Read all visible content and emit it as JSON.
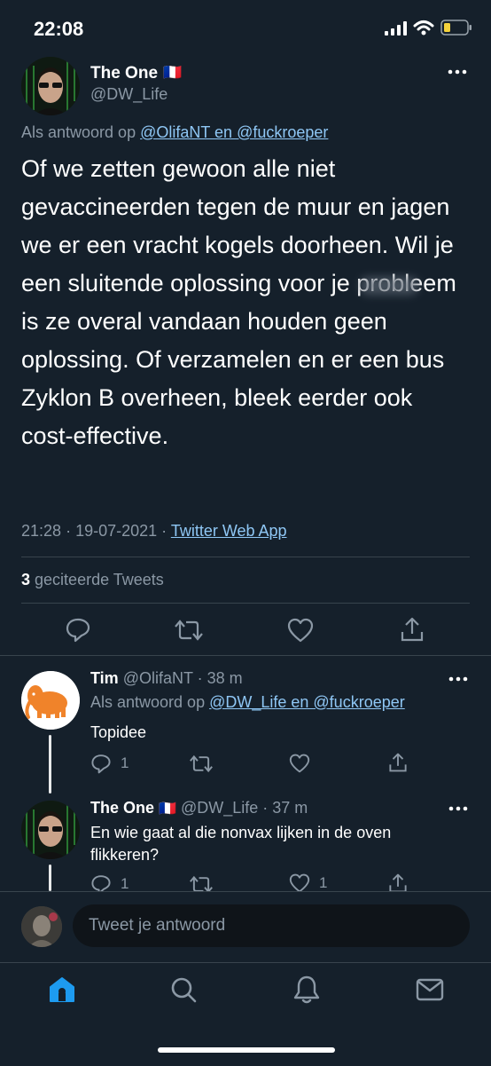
{
  "status_bar": {
    "time": "22:08"
  },
  "main_tweet": {
    "display_name": "The One",
    "flag": "🇫🇷",
    "handle": "@DW_Life",
    "reply_prefix": "Als antwoord op",
    "reply_targets": "@OlifaNT en @fuckroeper",
    "text": "Of we zetten gewoon alle niet gevaccineerden tegen de muur en jagen we er een vracht kogels doorheen. Wil je een sluitende oplossing voor je probleem is ze overal vandaan houden geen oplossing. Of verzamelen en er een bus Zyklon B overheen, bleek eerder ook cost-effective.",
    "time": "21:28",
    "date": "19-07-2021",
    "source": "Twitter Web App",
    "quote_count": "3",
    "quote_label": "geciteerde Tweets"
  },
  "replies": [
    {
      "display_name": "Tim",
      "handle": "@OlifaNT",
      "age": "38 m",
      "reply_prefix": "Als antwoord op",
      "reply_targets": "@DW_Life en @fuckroeper",
      "text": "Topidee",
      "reply_count": "1",
      "like_count": ""
    },
    {
      "display_name": "The One",
      "flag": "🇫🇷",
      "handle": "@DW_Life",
      "age": "37 m",
      "text": "En wie gaat al die nonvax lijken in de oven flikkeren?",
      "reply_count": "1",
      "like_count": "1"
    }
  ],
  "composer": {
    "placeholder": "Tweet je antwoord"
  },
  "colors": {
    "background": "#15202b",
    "accent": "#1d9bf0",
    "link": "#8fc7f5",
    "muted": "#8b98a5"
  }
}
